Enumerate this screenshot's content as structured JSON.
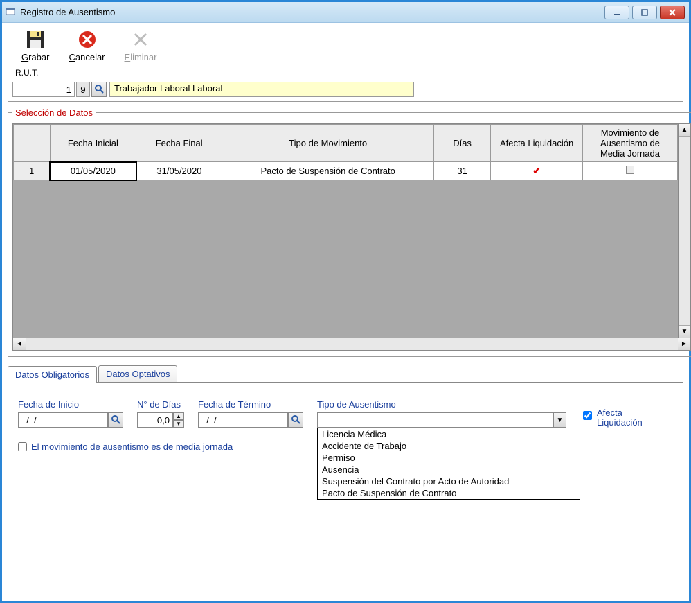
{
  "window": {
    "title": "Registro de Ausentismo"
  },
  "toolbar": {
    "grabar_label": "Grabar",
    "cancelar_label": "Cancelar",
    "eliminar_label": "Eliminar"
  },
  "rut": {
    "legend": "R.U.T.",
    "number": "1",
    "digit": "9",
    "worker_name": "Trabajador Laboral Laboral"
  },
  "seleccion": {
    "legend": "Selección de Datos",
    "columns": {
      "fecha_inicial": "Fecha Inicial",
      "fecha_final": "Fecha Final",
      "tipo_mov": "Tipo de Movimiento",
      "dias": "Días",
      "afecta": "Afecta Liquidación",
      "mov_media": "Movimiento de Ausentismo de Media Jornada"
    },
    "rows": [
      {
        "num": "1",
        "fecha_inicial": "01/05/2020",
        "fecha_final": "31/05/2020",
        "tipo_mov": "Pacto de Suspensión de Contrato",
        "dias": "31",
        "afecta": true,
        "media": false
      }
    ]
  },
  "tabs": {
    "obligatorios": "Datos Obligatorios",
    "optativos": "Datos Optativos"
  },
  "form": {
    "fecha_inicio_label": "Fecha de Inicio",
    "fecha_inicio_value": "  /  /",
    "n_dias_label": "N° de Días",
    "n_dias_value": "0,0",
    "fecha_termino_label": "Fecha de Término",
    "fecha_termino_value": "  /  /",
    "tipo_ausentismo_label": "Tipo de Ausentismo",
    "tipo_ausentismo_value": "",
    "afecta_label": "Afecta Liquidación",
    "afecta_checked": true,
    "media_label": "El movimiento de ausentismo es de media jornada",
    "media_checked": false,
    "tipo_options": [
      "Licencia Médica",
      "Accidente de Trabajo",
      "Permiso",
      "Ausencia",
      "Suspensión del Contrato por Acto de Autoridad",
      "Pacto de Suspensión de Contrato"
    ]
  }
}
